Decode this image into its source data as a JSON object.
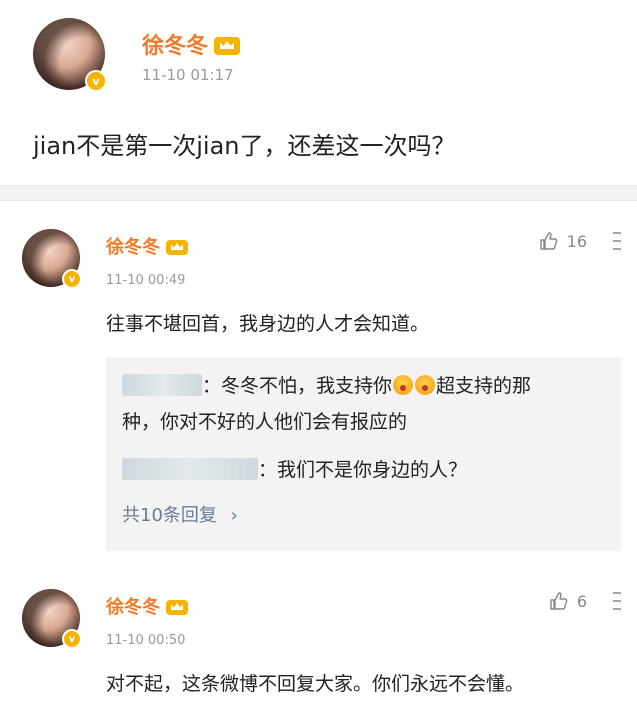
{
  "post": {
    "author": "徐冬冬",
    "time": "11-10 01:17",
    "text": "jian不是第一次jian了，还差这一次吗？"
  },
  "comments": [
    {
      "author": "徐冬冬",
      "time": "11-10 00:49",
      "likes": "16",
      "text": "往事不堪回首，我身边的人才会知道。",
      "replies": [
        {
          "text_before": "：冬冬不怕，我支持你",
          "text_after": "超支持的那",
          "line2": "种，你对不好的人他们会有报应的"
        },
        {
          "text": "：我们不是你身边的人？"
        }
      ],
      "reply_count": "共10条回复",
      "reply_chevron": "›"
    },
    {
      "author": "徐冬冬",
      "time": "11-10 00:50",
      "likes": "6",
      "text": "对不起，这条微博不回复大家。你们永远不会懂。"
    }
  ],
  "colors": {
    "name": "#f07b2a",
    "verified_badge": "#f5b400",
    "reply_link": "#6a7b98",
    "reply_bg": "#f3f3f3"
  },
  "icons": {
    "verified": "verified-v-icon",
    "crown": "vip-crown-icon",
    "like": "thumb-up-icon",
    "more": "more-options-icon",
    "emoji": "emoji-icon"
  }
}
